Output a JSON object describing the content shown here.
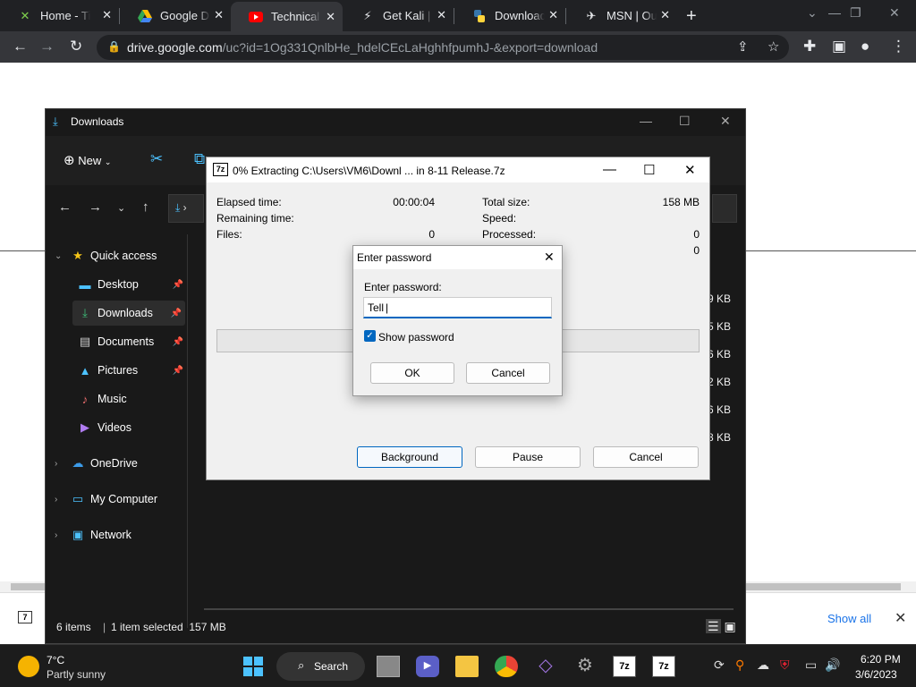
{
  "browser": {
    "tabs": [
      {
        "title": "Home - Tita",
        "icon": "x-logo-icon"
      },
      {
        "title": "Google Dri",
        "icon": "google-drive-icon"
      },
      {
        "title": "Technical A",
        "icon": "youtube-icon"
      },
      {
        "title": "Get Kali | K",
        "icon": "kali-icon"
      },
      {
        "title": "Download",
        "icon": "python-icon"
      },
      {
        "title": "MSN | Outl",
        "icon": "msn-icon"
      }
    ],
    "url_domain": "drive.google.com",
    "url_path": "/uc?id=1Og331QnlbHe_hdelCEcLaHghhfpumhJ-&export=download"
  },
  "explorer": {
    "title": "Downloads",
    "new_label": "New",
    "sidebar": {
      "quick_access": "Quick access",
      "items": [
        "Desktop",
        "Downloads",
        "Documents",
        "Pictures",
        "Music",
        "Videos"
      ],
      "onedrive": "OneDrive",
      "my_computer": "My Computer",
      "network": "Network"
    },
    "sizes": [
      "9 KB",
      "5 KB",
      "6 KB",
      "2 KB",
      "6 KB",
      "8 KB"
    ],
    "status_items": "6 items",
    "status_selected": "1 item selected  157 MB"
  },
  "sevenzip": {
    "title": "0% Extracting C:\\Users\\VM6\\Downl ... in 8-11 Release.7z",
    "elapsed_label": "Elapsed time:",
    "elapsed_value": "00:00:04",
    "remaining_label": "Remaining time:",
    "files_label": "Files:",
    "files_value": "0",
    "total_size_label": "Total size:",
    "total_size_value": "158 MB",
    "speed_label": "Speed:",
    "processed_label": "Processed:",
    "processed_value": "0",
    "extra_value": "0",
    "progress": 0,
    "btn_background": "Background",
    "btn_pause": "Pause",
    "btn_cancel": "Cancel"
  },
  "password_dialog": {
    "title": "Enter password",
    "label": "Enter password:",
    "value": "Tell",
    "show_password": "Show password",
    "ok": "OK",
    "cancel": "Cancel"
  },
  "download_bar": {
    "show_all": "Show all"
  },
  "taskbar": {
    "temperature": "7°C",
    "weather": "Partly sunny",
    "search": "Search",
    "time": "6:20 PM",
    "date": "3/6/2023"
  }
}
